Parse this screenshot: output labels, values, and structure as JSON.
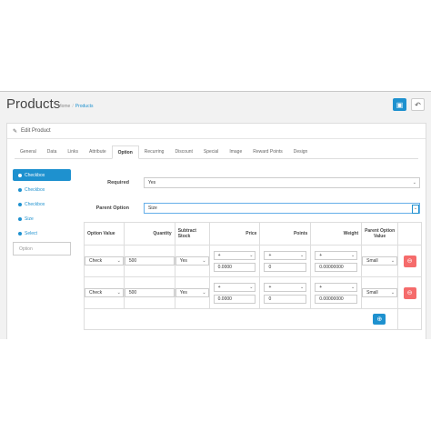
{
  "header": {
    "title": "Products",
    "breadcrumb": [
      "Home",
      "Products"
    ]
  },
  "panel": {
    "title": "Edit Product"
  },
  "tabs": [
    "General",
    "Data",
    "Links",
    "Attribute",
    "Option",
    "Recurring",
    "Discount",
    "Special",
    "Image",
    "Reward Points",
    "Design"
  ],
  "active_tab": "Option",
  "sidebar": {
    "items": [
      "Checkbox",
      "Checkbox",
      "Checkbox",
      "Size",
      "Select"
    ],
    "input_placeholder": "Option"
  },
  "form": {
    "required_label": "Required",
    "required_value": "Yes",
    "parent_label": "Parent Option",
    "parent_value": "Size"
  },
  "table": {
    "headers": {
      "option_value": "Option Value",
      "quantity": "Quantity",
      "subtract": "Subtract Stock",
      "price": "Price",
      "points": "Points",
      "weight": "Weight",
      "parent_value": "Parent Option Value"
    },
    "rows": [
      {
        "option_value": "Check",
        "quantity": "500",
        "subtract": "Yes",
        "price_prefix": "+",
        "price": "0.0000",
        "points_prefix": "+",
        "points": "0",
        "weight_prefix": "+",
        "weight": "0.00000000",
        "parent": "Small"
      },
      {
        "option_value": "Check",
        "quantity": "500",
        "subtract": "Yes",
        "price_prefix": "+",
        "price": "0.0000",
        "points_prefix": "+",
        "points": "0",
        "weight_prefix": "+",
        "weight": "0.00000000",
        "parent": "Small"
      }
    ]
  },
  "colors": {
    "primary": "#1e91cf",
    "danger": "#f56b6b"
  }
}
